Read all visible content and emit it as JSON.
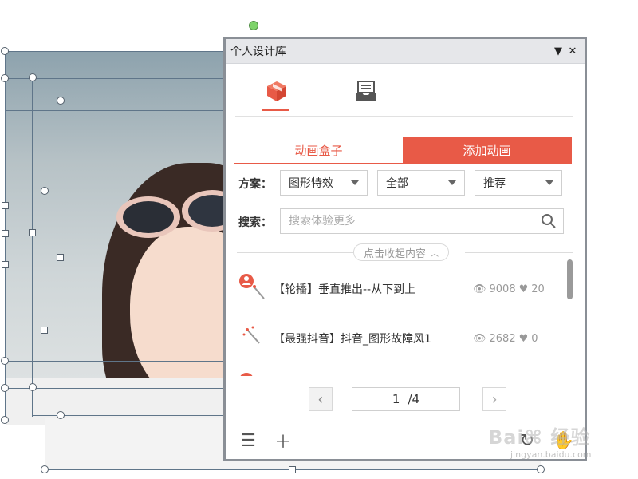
{
  "panel": {
    "title": "个人设计库",
    "tabs": [
      {
        "icon": "cube-icon",
        "active": true
      },
      {
        "icon": "inbox-tray-icon",
        "active": false
      }
    ],
    "toggle": {
      "option1": "动画盒子",
      "option2": "添加动画",
      "selected": "option2"
    },
    "filter": {
      "label": "方案：",
      "scheme": "图形特效",
      "scope": "全部",
      "sort": "推荐"
    },
    "search": {
      "label": "搜索：",
      "placeholder": "搜索体验更多"
    },
    "collapse_label": "点击收起内容",
    "items": [
      {
        "name": "【轮播】垂直推出--从下到上",
        "views": "9008",
        "likes": "20",
        "icon": "user-wand-icon"
      },
      {
        "name": "【最强抖音】抖音_图形故障风1",
        "views": "2682",
        "likes": "0",
        "icon": "wand-icon"
      }
    ],
    "pager": {
      "current": "1",
      "total": "/4"
    },
    "accent_color": "#e85a47"
  },
  "watermark": {
    "text": "Bai⌘ 经验",
    "sub": "jingyan.baidu.com"
  }
}
